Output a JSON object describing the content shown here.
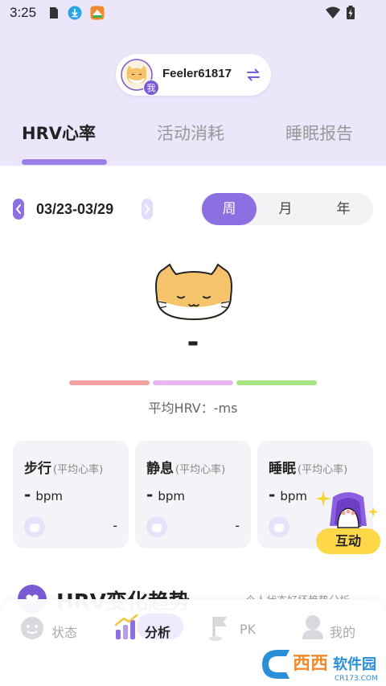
{
  "status_bar": {
    "time": "3:25"
  },
  "user": {
    "badge": "我",
    "username": "Feeler61817"
  },
  "tabs": [
    {
      "label": "HRV心率",
      "active": true
    },
    {
      "label": "活动消耗",
      "active": false
    },
    {
      "label": "睡眠报告",
      "active": false
    }
  ],
  "date_range": "03/23-03/29",
  "period": {
    "options": [
      "周",
      "月",
      "年"
    ],
    "selected": "周"
  },
  "hrv": {
    "value": "-",
    "avg_label": "平均HRV：-ms"
  },
  "cards": [
    {
      "title": "步行",
      "subtitle": "(平均心率)",
      "value": "-",
      "unit": "bpm",
      "footer": "-"
    },
    {
      "title": "静息",
      "subtitle": "(平均心率)",
      "value": "-",
      "unit": "bpm",
      "footer": "-"
    },
    {
      "title": "睡眠",
      "subtitle": "(平均心率)",
      "value": "-",
      "unit": "bpm",
      "footer": "-"
    }
  ],
  "interact_button": "互动",
  "trend": {
    "title": "HRV变化趋势",
    "hint": "个人状态好坏趋势分析"
  },
  "bottom_nav": [
    {
      "label": "状态",
      "icon": "status-face-icon",
      "active": false
    },
    {
      "label": "分析",
      "icon": "analysis-bars-icon",
      "active": true
    },
    {
      "label": "PK",
      "icon": "pk-flag-icon",
      "active": false
    },
    {
      "label": "我的",
      "icon": "profile-icon",
      "active": false
    }
  ],
  "watermark": {
    "brand": "西西软件园",
    "domain": "CR173.COM"
  },
  "colors": {
    "accent": "#8c6fe0",
    "header_bg": "#ece6fb",
    "bar_red": "#f3a0a0",
    "bar_pink": "#e8b6f3",
    "bar_green": "#a6e383",
    "interact_yellow": "#ffd84a"
  }
}
